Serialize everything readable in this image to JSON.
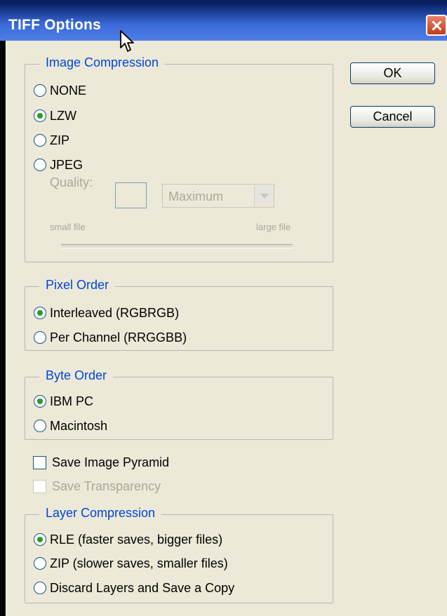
{
  "window": {
    "title": "TIFF Options"
  },
  "buttons": {
    "ok": "OK",
    "cancel": "Cancel"
  },
  "image_compression": {
    "legend": "Image Compression",
    "options": [
      {
        "label": "NONE",
        "selected": false
      },
      {
        "label": "LZW",
        "selected": true
      },
      {
        "label": "ZIP",
        "selected": false
      },
      {
        "label": "JPEG",
        "selected": false
      }
    ],
    "quality_label": "Quality:",
    "quality_value": "",
    "quality_select": "Maximum",
    "small_file": "small file",
    "large_file": "large file"
  },
  "pixel_order": {
    "legend": "Pixel Order",
    "options": [
      {
        "label": "Interleaved (RGBRGB)",
        "selected": true
      },
      {
        "label": "Per Channel (RRGGBB)",
        "selected": false
      }
    ]
  },
  "byte_order": {
    "legend": "Byte Order",
    "options": [
      {
        "label": "IBM PC",
        "selected": true
      },
      {
        "label": "Macintosh",
        "selected": false
      }
    ]
  },
  "checkboxes": {
    "save_pyramid": {
      "label": "Save Image Pyramid",
      "checked": false,
      "enabled": true
    },
    "save_transparency": {
      "label": "Save Transparency",
      "checked": false,
      "enabled": false
    }
  },
  "layer_compression": {
    "legend": "Layer Compression",
    "options": [
      {
        "label": "RLE (faster saves, bigger files)",
        "selected": true
      },
      {
        "label": "ZIP (slower saves, smaller files)",
        "selected": false
      },
      {
        "label": "Discard Layers and Save a Copy",
        "selected": false
      }
    ]
  },
  "colors": {
    "title_bar": "#0a246a",
    "face": "#ece9d8",
    "legend_text": "#0046d5",
    "radio_dot": "#21a121"
  }
}
